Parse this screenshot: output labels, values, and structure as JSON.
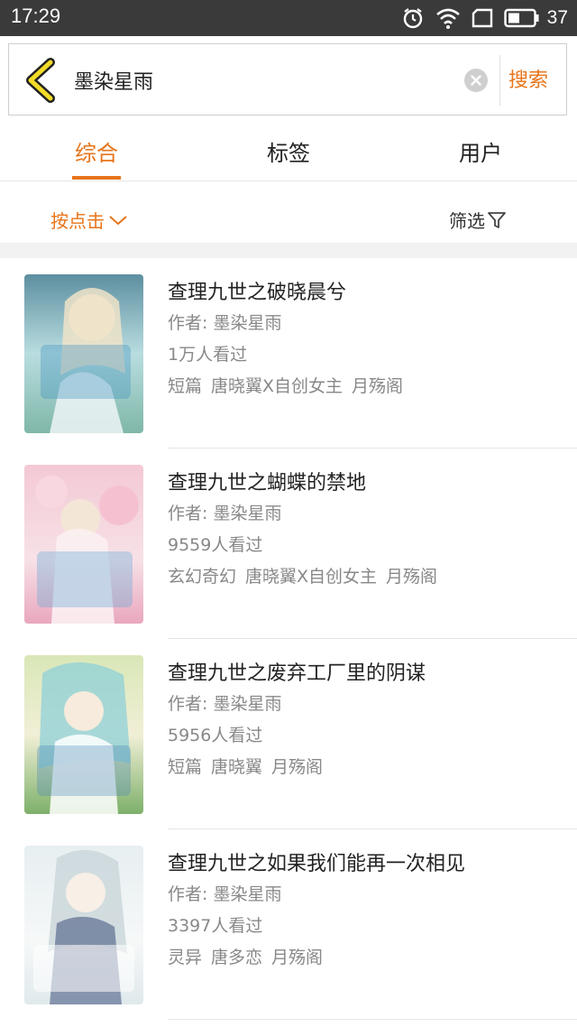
{
  "status": {
    "time": "17:29",
    "battery": "37"
  },
  "search": {
    "query": "墨染星雨",
    "button": "搜索"
  },
  "tabs": [
    {
      "label": "综合"
    },
    {
      "label": "标签"
    },
    {
      "label": "用户"
    }
  ],
  "filters": {
    "sort_label": "按点击",
    "filter_label": "筛选"
  },
  "results": [
    {
      "title": "查理九世之破晓晨兮",
      "author": "作者: 墨染星雨",
      "views": "1万人看过",
      "tags": [
        "短篇",
        "唐晓翼X自创女主",
        "月殇阁"
      ]
    },
    {
      "title": "查理九世之蝴蝶的禁地",
      "author": "作者: 墨染星雨",
      "views": "9559人看过",
      "tags": [
        "玄幻奇幻",
        "唐晓翼X自创女主",
        "月殇阁"
      ]
    },
    {
      "title": "查理九世之废弃工厂里的阴谋",
      "author": "作者: 墨染星雨",
      "views": "5956人看过",
      "tags": [
        "短篇",
        "唐晓翼",
        "月殇阁"
      ]
    },
    {
      "title": "查理九世之如果我们能再一次相见",
      "author": "作者: 墨染星雨",
      "views": "3397人看过",
      "tags": [
        "灵异",
        "唐多恋",
        "月殇阁"
      ]
    }
  ],
  "colors": {
    "accent": "#e8741a",
    "statusbar": "#3a3a3a"
  }
}
